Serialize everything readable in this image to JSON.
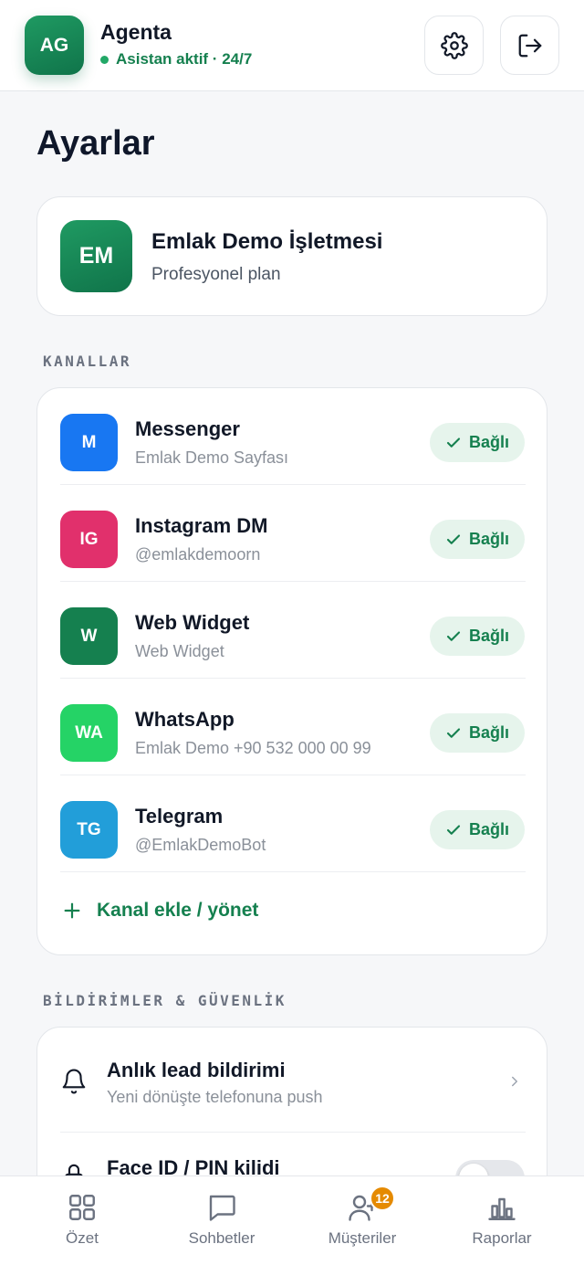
{
  "header": {
    "avatar_initials": "AG",
    "app_name": "Agenta",
    "status_text": "Asistan aktif · 24/7",
    "settings_icon": "gear-icon",
    "logout_icon": "logout-icon"
  },
  "page": {
    "title": "Ayarlar"
  },
  "business": {
    "initials": "EM",
    "name": "Emlak Demo İşletmesi",
    "plan": "Profesyonel plan"
  },
  "channels": {
    "section_label": "KANALLAR",
    "items": [
      {
        "initials": "M",
        "name": "Messenger",
        "sub": "Emlak Demo Sayfası",
        "status": "Bağlı",
        "color": "#1877f2"
      },
      {
        "initials": "IG",
        "name": "Instagram DM",
        "sub": "@emlakdemoorn",
        "status": "Bağlı",
        "color": "#e1306c"
      },
      {
        "initials": "W",
        "name": "Web Widget",
        "sub": "Web Widget",
        "status": "Bağlı",
        "color": "#15804f"
      },
      {
        "initials": "WA",
        "name": "WhatsApp",
        "sub": "Emlak Demo +90 532 000 00 99",
        "status": "Bağlı",
        "color": "#25d366"
      },
      {
        "initials": "TG",
        "name": "Telegram",
        "sub": "@EmlakDemoBot",
        "status": "Bağlı",
        "color": "#229ed9"
      }
    ],
    "add_label": "Kanal ekle / yönet"
  },
  "notifications": {
    "section_label": "BİLDİRİMLER & GÜVENLİK",
    "items": [
      {
        "title": "Anlık lead bildirimi",
        "sub": "Yeni dönüşte telefonuna push",
        "icon": "bell-icon"
      },
      {
        "title": "Face ID / PIN kilidi",
        "icon": "lock-icon",
        "toggle_on": false
      }
    ]
  },
  "bottom_nav": {
    "items": [
      {
        "label": "Özet",
        "icon": "grid-icon"
      },
      {
        "label": "Sohbetler",
        "icon": "chat-icon"
      },
      {
        "label": "Müşteriler",
        "icon": "user-add-icon",
        "badge": "12"
      },
      {
        "label": "Raporlar",
        "icon": "bar-chart-icon"
      }
    ]
  },
  "colors": {
    "accent": "#15804f",
    "badge_bg": "#e6f4ec",
    "notification_badge": "#e58a00"
  }
}
